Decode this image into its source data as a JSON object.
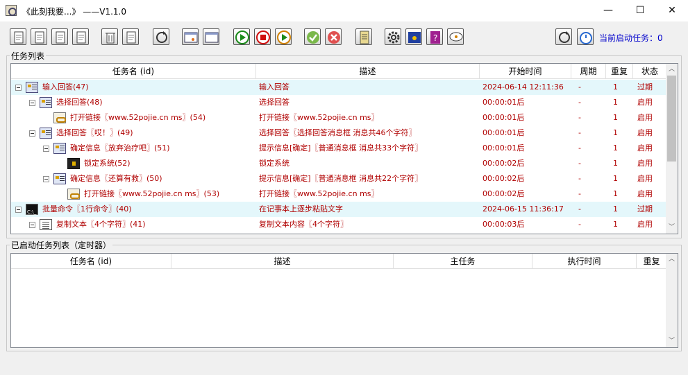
{
  "window": {
    "title": "《此刻我要...》     ——V1.1.0",
    "minimize": "—",
    "maximize": "☐",
    "close": "✕"
  },
  "toolbar": {
    "icons": [
      "new-task-icon",
      "paste-task-icon",
      "copy-task-icon",
      "clipboard-icon",
      "delete-icon",
      "clean-icon",
      "refresh-icon",
      "window-icon",
      "window2-icon",
      "start-icon",
      "stop-icon",
      "run-icon",
      "check-icon",
      "cancel-icon",
      "notes-icon",
      "settings-icon",
      "desktop-icon",
      "help-icon",
      "chat-icon",
      "reload-icon",
      "timer-icon"
    ],
    "status_label": "当前启动任务：0"
  },
  "task_list": {
    "legend": "任务列表",
    "columns": [
      "任务名 (id)",
      "描述",
      "开始时间",
      "周期",
      "重复",
      "状态"
    ],
    "rows": [
      {
        "level": 0,
        "expand": true,
        "icon": "msg",
        "name": "输入回答(47)",
        "desc": "输入回答",
        "time": "2024-06-14 12:11:36",
        "period": "-",
        "repeat": "1",
        "status": "过期",
        "highlight": true
      },
      {
        "level": 1,
        "expand": true,
        "icon": "msg",
        "name": "选择回答(48)",
        "desc": "选择回答",
        "time": "00:00:01后",
        "period": "-",
        "repeat": "1",
        "status": "启用",
        "highlight": false
      },
      {
        "level": 2,
        "expand": false,
        "icon": "link",
        "name": "打开链接〖www.52pojie.cn ms〗(54)",
        "desc": "打开链接〖www.52pojie.cn ms〗",
        "time": "00:00:01后",
        "period": "-",
        "repeat": "1",
        "status": "启用",
        "highlight": false
      },
      {
        "level": 1,
        "expand": true,
        "icon": "msg",
        "name": "选择回答〖哎！〗(49)",
        "desc": "选择回答〖选择回答消息框 消息共46个字符〗",
        "time": "00:00:01后",
        "period": "-",
        "repeat": "1",
        "status": "启用",
        "highlight": false
      },
      {
        "level": 2,
        "expand": true,
        "icon": "msg",
        "name": "确定信息〖放弃治疗吧〗(51)",
        "desc": "提示信息[确定]〖普通消息框 消息共33个字符〗",
        "time": "00:00:01后",
        "period": "-",
        "repeat": "1",
        "status": "启用",
        "highlight": false
      },
      {
        "level": 3,
        "expand": false,
        "icon": "lock",
        "name": "锁定系统(52)",
        "desc": "锁定系统",
        "time": "00:00:02后",
        "period": "-",
        "repeat": "1",
        "status": "启用",
        "highlight": false
      },
      {
        "level": 2,
        "expand": true,
        "icon": "msg",
        "name": "确定信息〖还算有救〗(50)",
        "desc": "提示信息[确定]〖普通消息框 消息共22个字符〗",
        "time": "00:00:02后",
        "period": "-",
        "repeat": "1",
        "status": "启用",
        "highlight": false
      },
      {
        "level": 3,
        "expand": false,
        "icon": "link",
        "name": "打开链接〖www.52pojie.cn ms〗(53)",
        "desc": "打开链接〖www.52pojie.cn ms〗",
        "time": "00:00:02后",
        "period": "-",
        "repeat": "1",
        "status": "启用",
        "highlight": false
      },
      {
        "level": 0,
        "expand": true,
        "icon": "cmd",
        "name": "批量命令〖1行命令〗(40)",
        "desc": "在记事本上逐步粘贴文字",
        "time": "2024-06-15 11:36:17",
        "period": "-",
        "repeat": "1",
        "status": "过期",
        "highlight": true
      },
      {
        "level": 1,
        "expand": true,
        "icon": "doc",
        "name": "复制文本〖4个字符〗(41)",
        "desc": "复制文本内容〖4个字符〗",
        "time": "00:00:03后",
        "period": "-",
        "repeat": "1",
        "status": "启用",
        "highlight": false
      }
    ]
  },
  "timer_list": {
    "legend": "已启动任务列表（定时器）",
    "columns": [
      "任务名 (id)",
      "描述",
      "主任务",
      "执行时间",
      "重复"
    ]
  }
}
